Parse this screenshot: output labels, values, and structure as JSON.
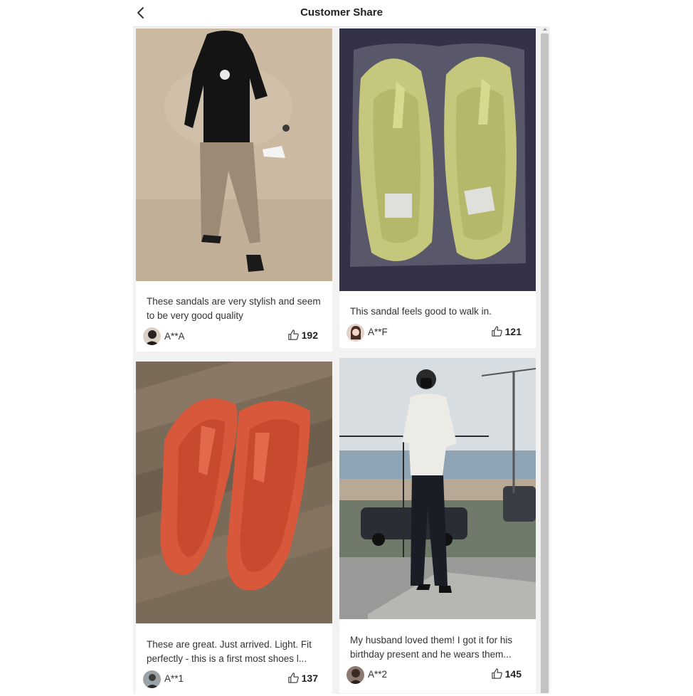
{
  "header": {
    "title": "Customer Share",
    "back_icon": "chevron-left-icon"
  },
  "posts": [
    {
      "caption": "These sandals are very stylish and seem to be very good quality",
      "user": "A**A",
      "likes": "192",
      "photo": "woman-in-khaki-pants-on-sand"
    },
    {
      "caption": "This sandal feels good to walk in.",
      "user": "A**F",
      "likes": "121",
      "photo": "olive-green-flip-flops-in-plastic"
    },
    {
      "caption": "These are great. Just arrived. Light. Fit perfectly - this is a first most shoes l...",
      "user": "A**1",
      "likes": "137",
      "photo": "orange-flip-flops-on-wood-floor"
    },
    {
      "caption": "My husband loved them! I got it for his birthday present and he wears them...",
      "user": "A**2",
      "likes": "145",
      "photo": "man-by-seaside-in-flip-flops"
    }
  ],
  "colors": {
    "background": "#ffffff",
    "panel": "#f2f2f2",
    "card": "#ffffff",
    "text": "#333333",
    "scrollbar_thumb": "#c3c3c3"
  }
}
